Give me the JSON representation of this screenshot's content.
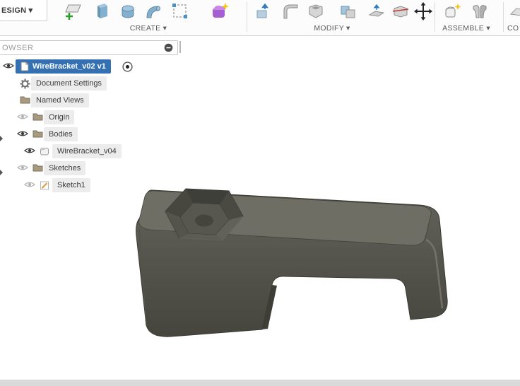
{
  "toolbar": {
    "workspace": "ESIGN ▾",
    "groups": {
      "create": "CREATE ▾",
      "modify": "MODIFY ▾",
      "assemble": "ASSEMBLE ▾",
      "construct": "CO"
    }
  },
  "browser": {
    "title": "OWSER",
    "items": [
      {
        "label": "WireBracket_v02 v1",
        "icon": "document",
        "visibility": "visible",
        "selected": true
      },
      {
        "label": "Document Settings",
        "icon": "gear"
      },
      {
        "label": "Named Views",
        "icon": "folder"
      },
      {
        "label": "Origin",
        "icon": "folder",
        "visibility": "hidden"
      },
      {
        "label": "Bodies",
        "icon": "folder",
        "visibility": "visible",
        "expanded": true
      },
      {
        "label": "WireBracket_v04",
        "icon": "body",
        "visibility": "visible"
      },
      {
        "label": "Sketches",
        "icon": "folder",
        "visibility": "hidden",
        "expanded": true
      },
      {
        "label": "Sketch1",
        "icon": "sketch",
        "visibility": "hidden"
      }
    ]
  },
  "colors": {
    "selection_blue": "#3470b2",
    "pill_gray": "#ececec",
    "model_top": "#6e6e65",
    "model_front_dark": "#45453d",
    "toolbar_label": "#5a5a5a"
  },
  "icons": [
    "create-sketch",
    "extrude",
    "revolve",
    "sweep",
    "rectangular-pattern",
    "create-form",
    "press-pull",
    "fillet",
    "shell",
    "combine",
    "offset-face",
    "split-body",
    "move-copy",
    "new-component",
    "joint",
    "construct-partial",
    "visibility-eye",
    "folder",
    "gear",
    "document",
    "body",
    "sketch",
    "activate-radio",
    "collapse-all"
  ]
}
